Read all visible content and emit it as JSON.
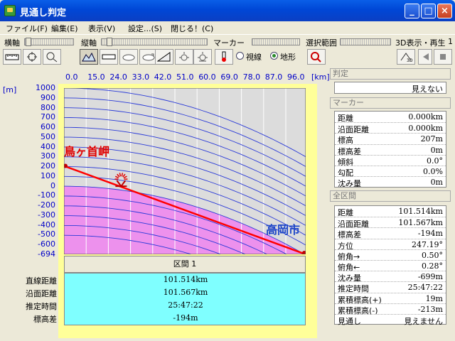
{
  "window": {
    "title": "見通し判定",
    "minimize_label": "_",
    "maximize_label": "□",
    "close_label": "×"
  },
  "menu": [
    "ファイル(F)",
    "編集(E)",
    "表示(V)",
    "設定...(S)",
    "閉じる！(C)"
  ],
  "toolbar": {
    "horizontal_axis_label": "横軸",
    "vertical_axis_label": "縦軸",
    "marker_label": "マーカー",
    "radio_line_of_sight": "視線",
    "radio_terrain": "地形",
    "selection_range_label": "選択範囲",
    "view3d_label": "3D表示・再生",
    "view3d_value": "1"
  },
  "chart_data": {
    "type": "line",
    "x_unit": "[km]",
    "y_unit": "[m]",
    "x_ticks": [
      "0.0",
      "15.0",
      "24.0",
      "33.0",
      "42.0",
      "51.0",
      "60.0",
      "69.0",
      "78.0",
      "87.0",
      "96.0"
    ],
    "y_ticks": [
      "1000",
      "900",
      "800",
      "700",
      "600",
      "500",
      "400",
      "300",
      "200",
      "100",
      "0",
      "-100",
      "-200",
      "-300",
      "-400",
      "-500",
      "-600",
      "-694"
    ],
    "xlim": [
      0,
      101.514
    ],
    "ylim": [
      -694,
      1000
    ],
    "series": [
      {
        "name": "",
        "x": [
          0,
          101.514
        ],
        "y": [
          207,
          -694
        ]
      }
    ],
    "marker": {
      "x": 24.0,
      "y": 0
    },
    "start_label": "鳥ヶ首岬",
    "end_label": "高岡市",
    "colors": {
      "sky": "#DCDCDC",
      "terrain": "#EE88EE",
      "curves": "#2B3BD8",
      "line": "#FF0000"
    }
  },
  "section": {
    "header": "区間 1",
    "labels": [
      "直線距離",
      "沿面距離",
      "推定時間",
      "標高差"
    ],
    "values": [
      "101.514km",
      "101.567km",
      "25:47:22",
      "-194m"
    ]
  },
  "judgement": {
    "header": "判定",
    "value": "見えない"
  },
  "marker_panel": {
    "header": "マーカー",
    "rows": [
      {
        "k": "距離",
        "v": "0.000km"
      },
      {
        "k": "沿面距離",
        "v": "0.000km"
      },
      {
        "k": "標高",
        "v": "207m"
      },
      {
        "k": "標高差",
        "v": "0m"
      },
      {
        "k": "傾斜",
        "v": "0.0°"
      },
      {
        "k": "勾配",
        "v": "0.0%"
      },
      {
        "k": "沈み量",
        "v": "0m"
      }
    ]
  },
  "total_panel": {
    "header": "全区間",
    "rows": [
      {
        "k": "距離",
        "v": "101.514km"
      },
      {
        "k": "沿面距離",
        "v": "101.567km"
      },
      {
        "k": "標高差",
        "v": "-194m"
      },
      {
        "k": "方位",
        "v": "247.19°"
      },
      {
        "k": "俯角→",
        "v": "0.50°"
      },
      {
        "k": "俯角←",
        "v": "0.28°"
      },
      {
        "k": "沈み量",
        "v": "-699m"
      },
      {
        "k": "推定時間",
        "v": "25:47:22"
      },
      {
        "k": "累積標高(+)",
        "v": "19m"
      },
      {
        "k": "累積標高(-)",
        "v": "-213m"
      },
      {
        "k": "見通し",
        "v": "見えません"
      }
    ]
  }
}
